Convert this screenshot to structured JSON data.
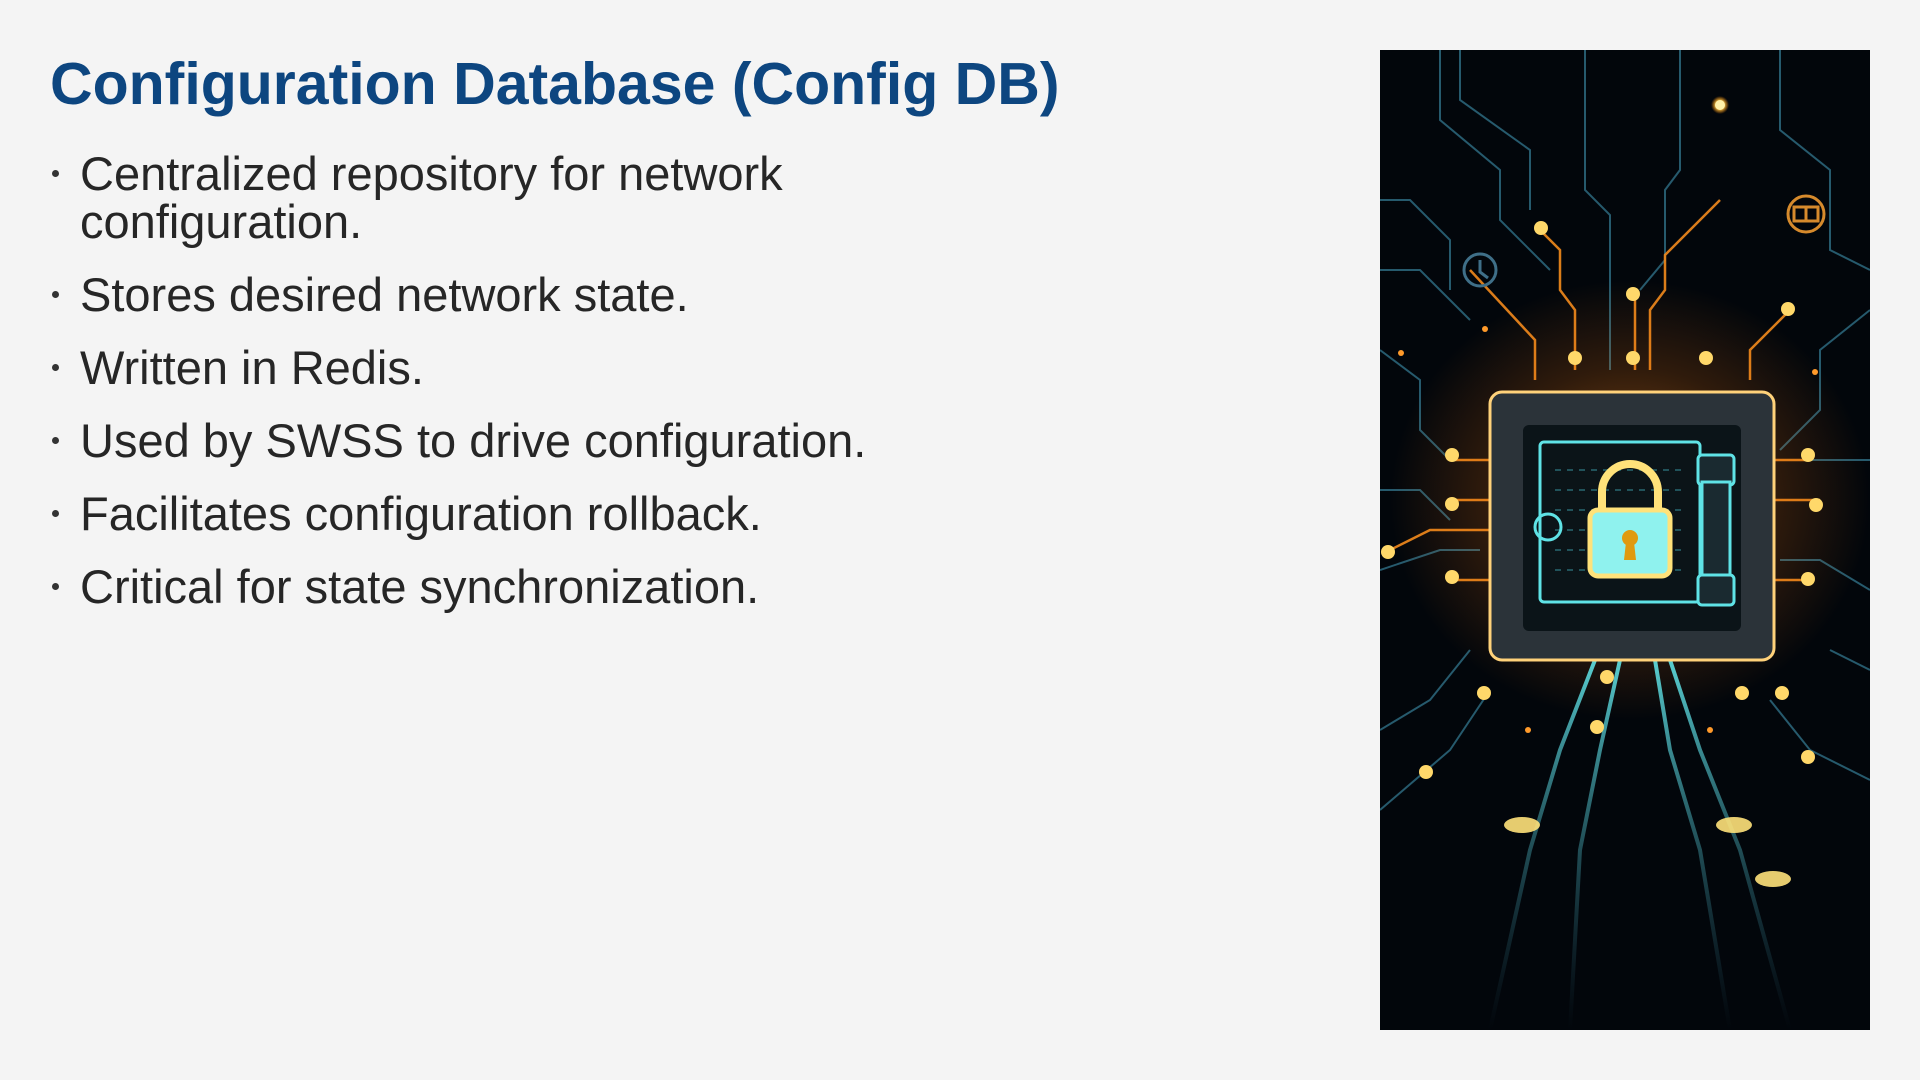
{
  "slide": {
    "title": "Configuration Database (Config DB)",
    "bullets": [
      "Centralized repository for network configuration.",
      "Stores desired network state.",
      "Written in Redis.",
      "Used by SWSS to drive configuration.",
      "Facilitates configuration rollback.",
      "Critical for state synchronization."
    ]
  },
  "image": {
    "subject": "secure-vault-circuit-illustration",
    "icons": [
      "padlock-icon",
      "clock-icon",
      "book-icon"
    ],
    "colors": {
      "background": "#02060b",
      "circuit_blue": "#2f6f86",
      "circuit_orange": "#f28a1c",
      "glow_cyan": "#5fe3e6",
      "glow_yellow": "#ffd86a",
      "vault_body": "#2b3339"
    }
  }
}
